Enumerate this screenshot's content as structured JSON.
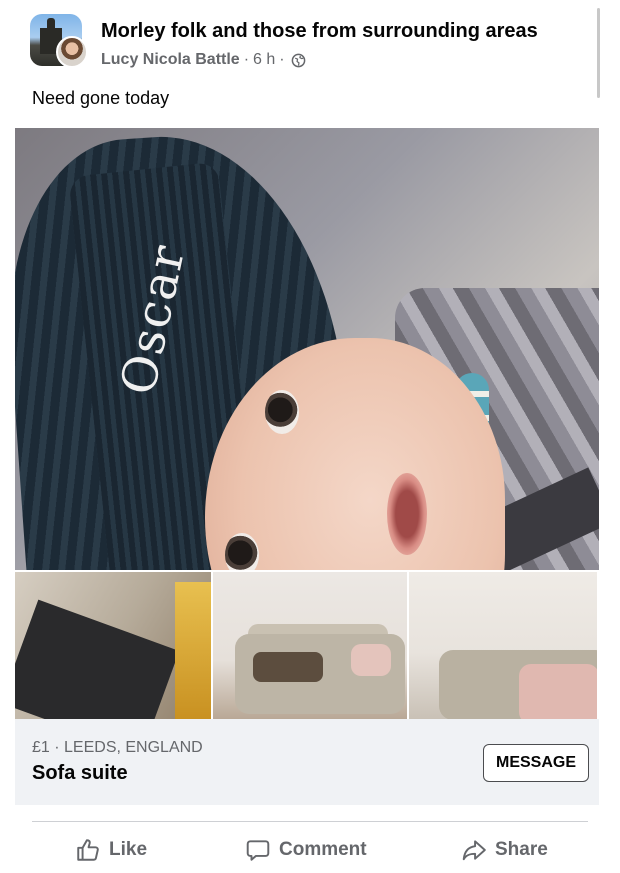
{
  "post": {
    "group_name": "Morley folk and those from surrounding areas",
    "author": "Lucy Nicola Battle",
    "time": "6 h",
    "separator": "·",
    "text": "Need gone today"
  },
  "listing": {
    "price_location": "£1 · LEEDS, ENGLAND",
    "title": "Sofa suite",
    "message_label": "MESSAGE"
  },
  "actions": {
    "like_label": "Like",
    "comment_label": "Comment",
    "share_label": "Share"
  },
  "photos": {
    "hat_text": "Oscar"
  },
  "icons": {
    "audience": "globe-icon",
    "like": "thumbs-up-icon",
    "comment": "comment-bubble-icon",
    "share": "share-arrow-icon"
  },
  "colors": {
    "text_primary": "#050505",
    "text_secondary": "#65676b",
    "listing_bg": "#f0f2f5"
  }
}
